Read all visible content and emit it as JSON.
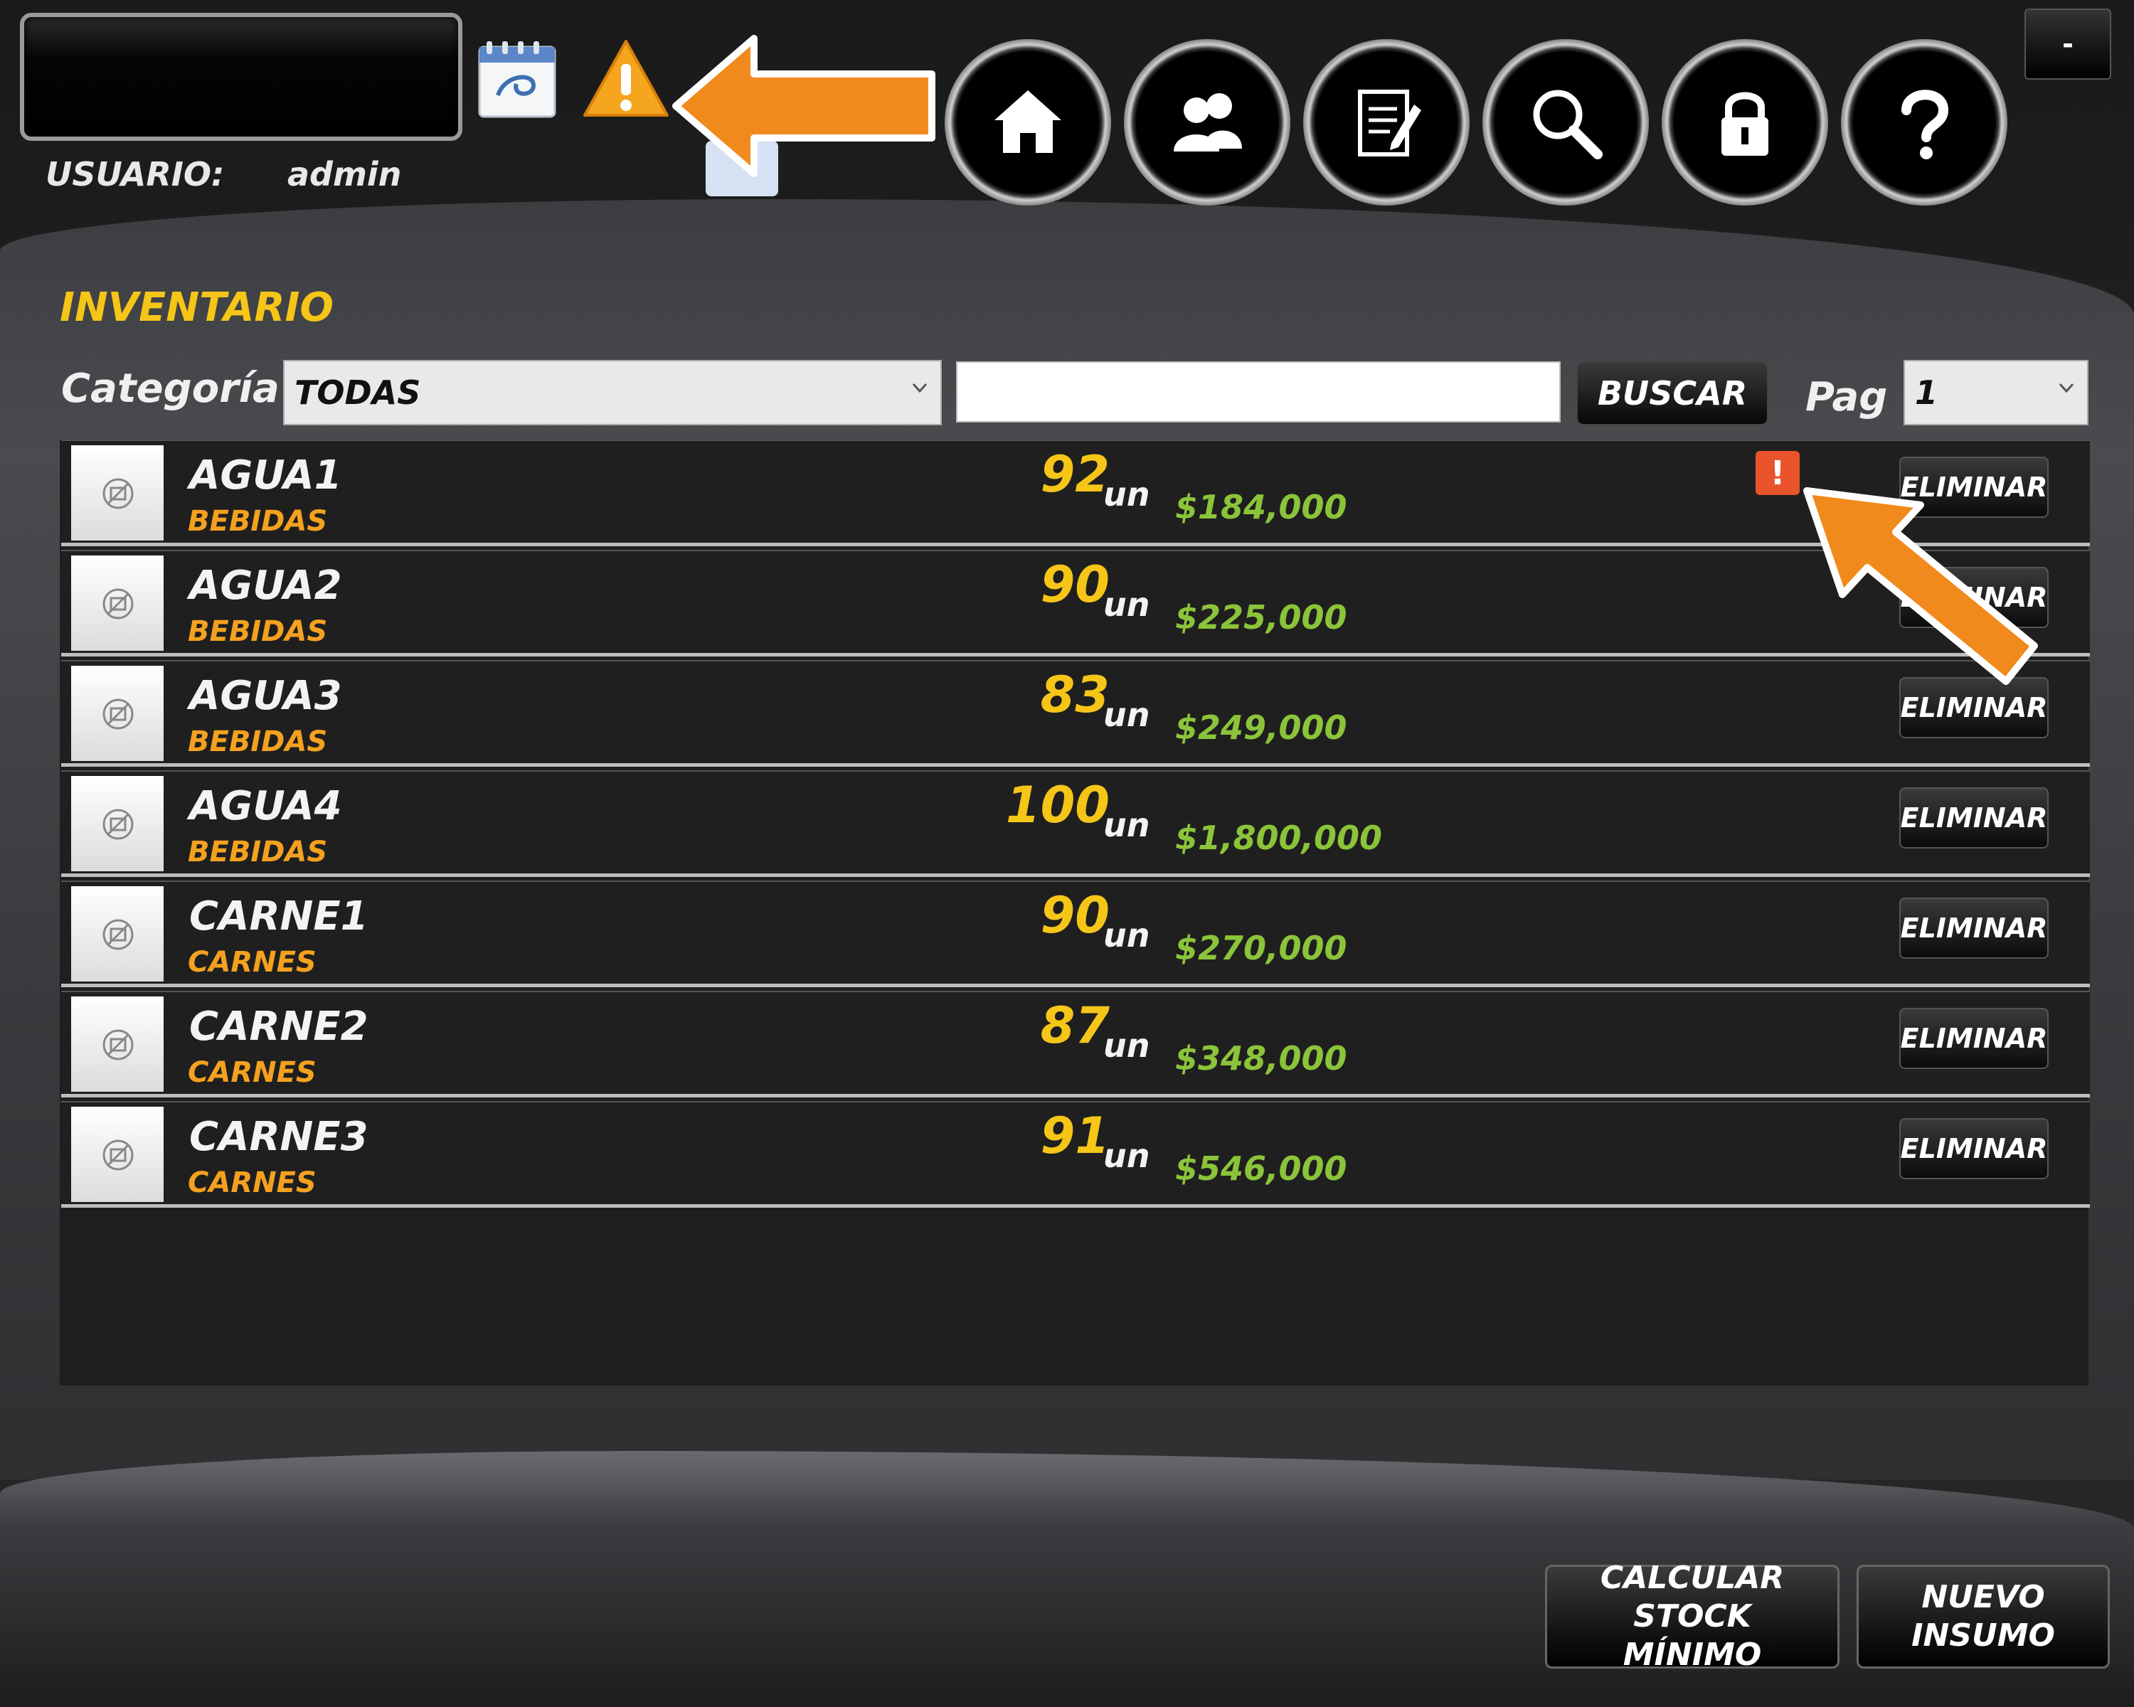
{
  "header": {
    "user_label": "USUARIO:",
    "user_value": "admin",
    "minimize_label": "-",
    "nav": [
      {
        "name": "home",
        "icon": "home-icon"
      },
      {
        "name": "users",
        "icon": "users-icon"
      },
      {
        "name": "notes",
        "icon": "notepad-icon"
      },
      {
        "name": "search",
        "icon": "search-icon"
      },
      {
        "name": "lock",
        "icon": "lock-icon"
      },
      {
        "name": "help",
        "icon": "question-icon"
      }
    ]
  },
  "page": {
    "title": "INVENTARIO",
    "category_label": "Categoría",
    "category_selected": "TODAS",
    "search_value": "",
    "search_button": "BUSCAR",
    "page_label": "Pag",
    "page_selected": "1"
  },
  "items": [
    {
      "name": "AGUA1",
      "category": "BEBIDAS",
      "qty": "92",
      "unit": "un",
      "price": "$184,000",
      "alert": true,
      "delete_label": "ELIMINAR"
    },
    {
      "name": "AGUA2",
      "category": "BEBIDAS",
      "qty": "90",
      "unit": "un",
      "price": "$225,000",
      "alert": false,
      "delete_label": "ELIMINAR"
    },
    {
      "name": "AGUA3",
      "category": "BEBIDAS",
      "qty": "83",
      "unit": "un",
      "price": "$249,000",
      "alert": false,
      "delete_label": "ELIMINAR"
    },
    {
      "name": "AGUA4",
      "category": "BEBIDAS",
      "qty": "100",
      "unit": "un",
      "price": "$1,800,000",
      "alert": false,
      "delete_label": "ELIMINAR"
    },
    {
      "name": "CARNE1",
      "category": "CARNES",
      "qty": "90",
      "unit": "un",
      "price": "$270,000",
      "alert": false,
      "delete_label": "ELIMINAR"
    },
    {
      "name": "CARNE2",
      "category": "CARNES",
      "qty": "87",
      "unit": "un",
      "price": "$348,000",
      "alert": false,
      "delete_label": "ELIMINAR"
    },
    {
      "name": "CARNE3",
      "category": "CARNES",
      "qty": "91",
      "unit": "un",
      "price": "$546,000",
      "alert": false,
      "delete_label": "ELIMINAR"
    }
  ],
  "alert_badge": "!",
  "footer": {
    "calc_button_line1": "CALCULAR STOCK",
    "calc_button_line2": "MÍNIMO",
    "new_button": "NUEVO INSUMO"
  },
  "colors": {
    "title": "#f5c518",
    "quantity": "#f5c518",
    "category": "#f4a11f",
    "price": "#8bc43a",
    "annotation_arrow": "#f08a1c",
    "alert": "#e8532b"
  }
}
